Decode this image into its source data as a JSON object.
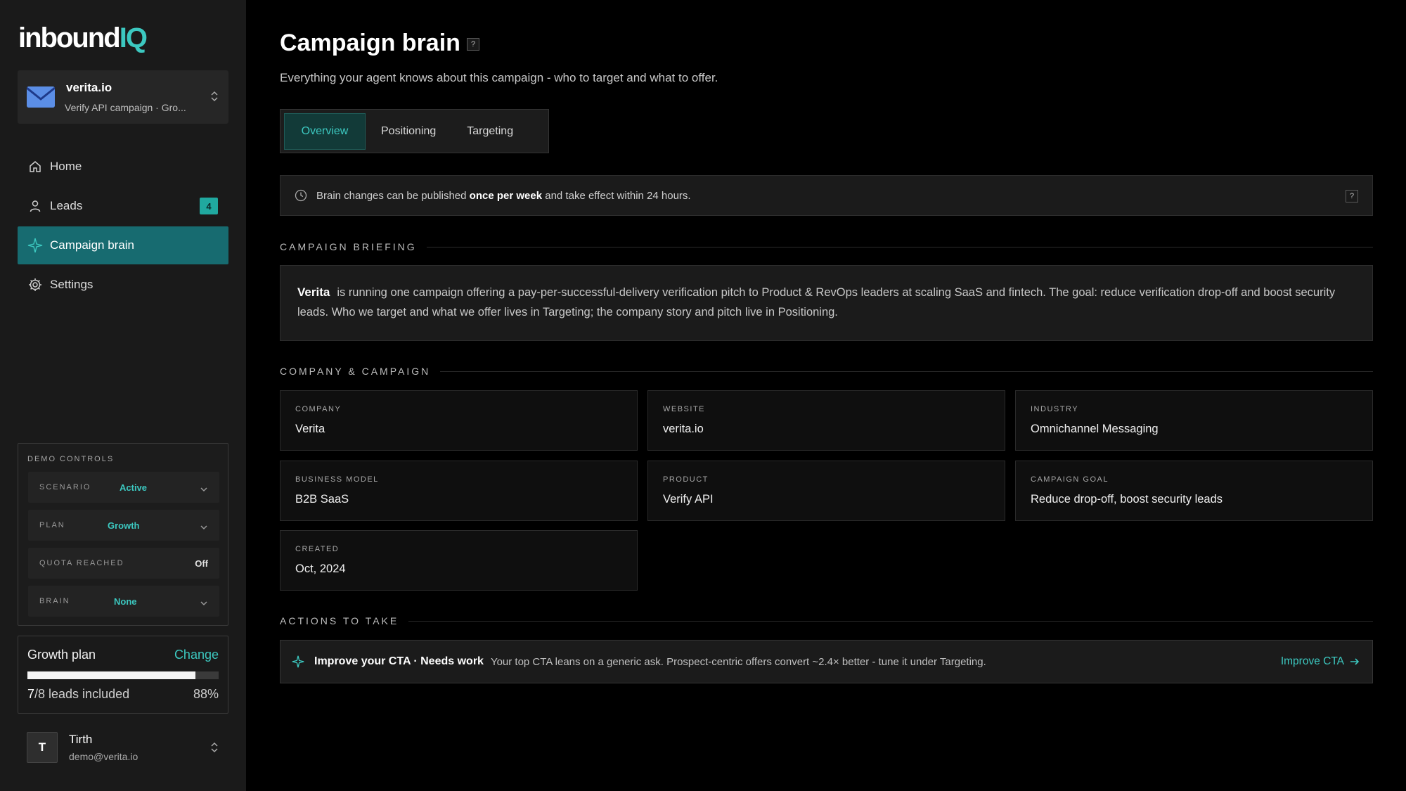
{
  "brand": {
    "logo_main": "inbound",
    "logo_accent": "IQ",
    "accent_color": "#3cc8c0"
  },
  "workspace": {
    "name": "verita.io",
    "subtitle": "Verify API campaign · Gro..."
  },
  "nav": {
    "items": [
      {
        "label": "Home",
        "icon": "home-icon"
      },
      {
        "label": "Leads",
        "icon": "user-icon",
        "badge": "4"
      },
      {
        "label": "Campaign brain",
        "icon": "sparkle-icon",
        "active": true
      },
      {
        "label": "Settings",
        "icon": "gear-icon"
      }
    ]
  },
  "demo_controls": {
    "title": "DEMO CONTROLS",
    "rows": [
      {
        "label": "SCENARIO",
        "value": "Active"
      },
      {
        "label": "PLAN",
        "value": "Growth"
      },
      {
        "label": "QUOTA REACHED",
        "value": "Off"
      },
      {
        "label": "BRAIN",
        "value": "None"
      }
    ]
  },
  "plan": {
    "title": "Growth plan",
    "change_label": "Change",
    "leads_used": "7",
    "leads_total_text": "/8 leads included",
    "percent_text": "88%",
    "progress": 0.88
  },
  "user": {
    "initial": "T",
    "name": "Tirth",
    "email": "demo@verita.io"
  },
  "header": {
    "title": "Campaign brain",
    "help": "?",
    "subtitle": "Everything your agent knows about this campaign - who to target and what to offer."
  },
  "tabs": [
    {
      "label": "Overview",
      "active": true
    },
    {
      "label": "Positioning"
    },
    {
      "label": "Targeting"
    }
  ],
  "notice": {
    "before": "Brain changes can be published ",
    "bold": "once per week",
    "after": " and take effect within 24 hours.",
    "help": "?"
  },
  "briefing": {
    "heading": "CAMPAIGN BRIEFING",
    "company": "Verita",
    "text": "is running one campaign offering a pay-per-successful-delivery verification pitch to Product & RevOps leaders at scaling SaaS and fintech. The goal: reduce verification drop-off and boost security leads. Who we target and what we offer lives in Targeting; the company story and pitch live in Positioning."
  },
  "company_campaign": {
    "heading": "COMPANY & CAMPAIGN",
    "fields": [
      {
        "label": "COMPANY",
        "value": "Verita"
      },
      {
        "label": "WEBSITE",
        "value": "verita.io"
      },
      {
        "label": "INDUSTRY",
        "value": "Omnichannel Messaging"
      },
      {
        "label": "BUSINESS MODEL",
        "value": "B2B SaaS"
      },
      {
        "label": "PRODUCT",
        "value": "Verify API"
      },
      {
        "label": "CAMPAIGN GOAL",
        "value": "Reduce drop-off, boost security leads"
      },
      {
        "label": "CREATED",
        "value": "Oct, 2024"
      }
    ]
  },
  "actions": {
    "heading": "ACTIONS TO TAKE",
    "items": [
      {
        "title": "Improve your CTA · Needs work",
        "description": "Your top CTA leans on a generic ask. Prospect-centric offers convert ~2.4× better - tune it under Targeting.",
        "link": "Improve CTA"
      }
    ]
  }
}
